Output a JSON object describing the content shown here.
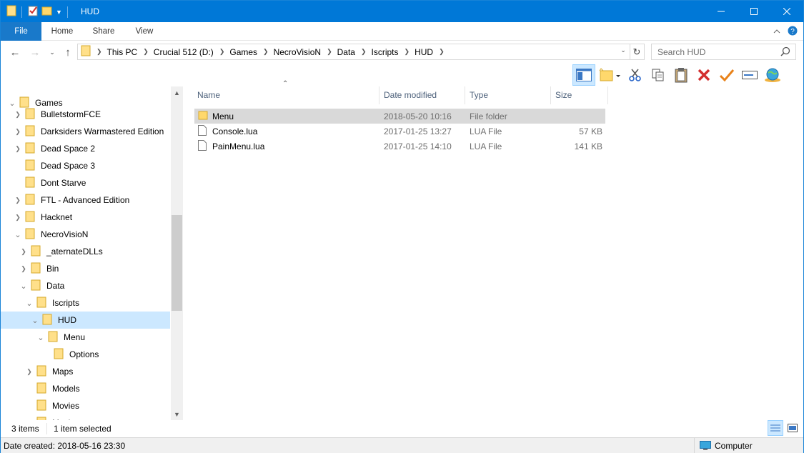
{
  "window": {
    "title": "HUD"
  },
  "ribbon": {
    "tabs": [
      "File",
      "Home",
      "Share",
      "View"
    ]
  },
  "address": {
    "crumbs": [
      "This PC",
      "Crucial 512 (D:)",
      "Games",
      "NecroVisioN",
      "Data",
      "Iscripts",
      "HUD"
    ]
  },
  "search": {
    "placeholder": "Search HUD"
  },
  "tree": [
    {
      "label": "Games",
      "expanded": true
    },
    {
      "label": "BulletstormFCE",
      "expanded": false
    },
    {
      "label": "Darksiders Warmastered Edition",
      "expanded": false
    },
    {
      "label": "Dead Space 2",
      "expanded": false
    },
    {
      "label": "Dead Space 3",
      "expanded": null
    },
    {
      "label": "Dont Starve",
      "expanded": null
    },
    {
      "label": "FTL - Advanced Edition",
      "expanded": false
    },
    {
      "label": "Hacknet",
      "expanded": false
    },
    {
      "label": "NecroVisioN",
      "expanded": true
    },
    {
      "label": "_aternateDLLs",
      "expanded": false
    },
    {
      "label": "Bin",
      "expanded": false
    },
    {
      "label": "Data",
      "expanded": true
    },
    {
      "label": "Iscripts",
      "expanded": true
    },
    {
      "label": "HUD",
      "expanded": true,
      "selected": true
    },
    {
      "label": "Menu",
      "expanded": true
    },
    {
      "label": "Options",
      "expanded": null
    },
    {
      "label": "Maps",
      "expanded": false
    },
    {
      "label": "Models",
      "expanded": null
    },
    {
      "label": "Movies",
      "expanded": null
    },
    {
      "label": "Music",
      "expanded": null
    }
  ],
  "columns": {
    "name": "Name",
    "date": "Date modified",
    "type": "Type",
    "size": "Size"
  },
  "files": [
    {
      "name": "Menu",
      "date": "2018-05-20 10:16",
      "type": "File folder",
      "size": "",
      "icon": "folder-icon",
      "selected": true
    },
    {
      "name": "Console.lua",
      "date": "2017-01-25 13:27",
      "type": "LUA File",
      "size": "57 KB",
      "icon": "file-icon",
      "selected": false
    },
    {
      "name": "PainMenu.lua",
      "date": "2017-01-25 14:10",
      "type": "LUA File",
      "size": "141 KB",
      "icon": "file-icon",
      "selected": false
    }
  ],
  "status": {
    "count": "3 items",
    "selection": "1 item selected"
  },
  "bottom": {
    "date_created": "Date created: 2018-05-16 23:30",
    "location": "Computer"
  },
  "colors": {
    "titlebar": "#0078d7",
    "selection": "#cce8ff",
    "folder": "#ffd86c"
  }
}
